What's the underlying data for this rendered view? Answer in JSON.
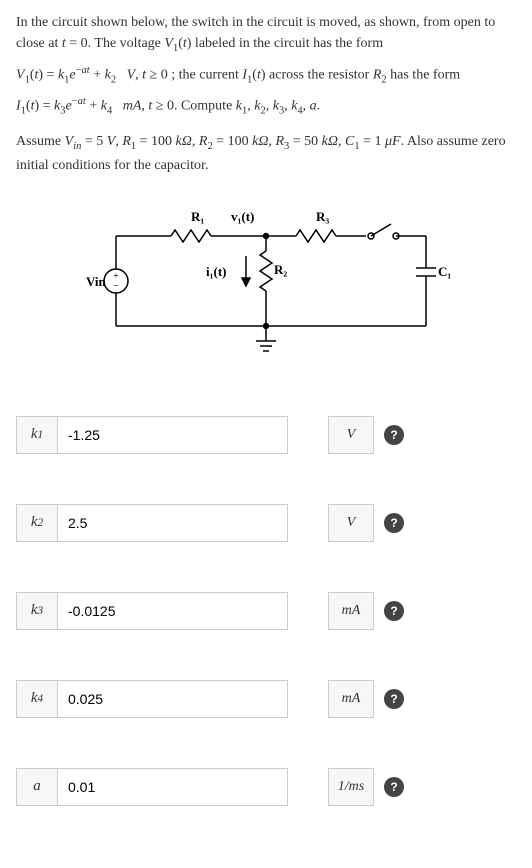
{
  "problem": {
    "p1": "In the circuit shown below, the switch in the circuit is moved, as shown, from open to close at t = 0. The voltage V₁(t) labeled in the circuit has the form",
    "p2": "V₁(t) = k₁e⁻ᵃᵗ + k₂   V, t ≥ 0 ; the current I₁(t) across the resistor R₂ has the form",
    "p3": "I₁(t) = k₃e⁻ᵃᵗ + k₄   mA, t ≥ 0. Compute k₁, k₂, k₃, k₄, a.",
    "p4": "Assume Vᵢₙ = 5 V, R₁ = 100 kΩ, R₂ = 100 kΩ, R₃ = 50 kΩ, C₁ = 1 μF. Also assume zero initial conditions for the capacitor."
  },
  "circuit": {
    "Vin": "Vin",
    "R1": "R₁",
    "v1t": "v₁(t)",
    "R2": "R₂",
    "R3": "R₃",
    "C1": "C₁",
    "i1t": "i₁(t)"
  },
  "answers": [
    {
      "label": "k₁",
      "value": "-1.25",
      "unit": "V"
    },
    {
      "label": "k₂",
      "value": "2.5",
      "unit": "V"
    },
    {
      "label": "k₃",
      "value": "-0.0125",
      "unit": "mA"
    },
    {
      "label": "k₄",
      "value": "0.025",
      "unit": "mA"
    },
    {
      "label": "a",
      "value": "0.01",
      "unit": "1/ms"
    }
  ],
  "help_symbol": "?"
}
